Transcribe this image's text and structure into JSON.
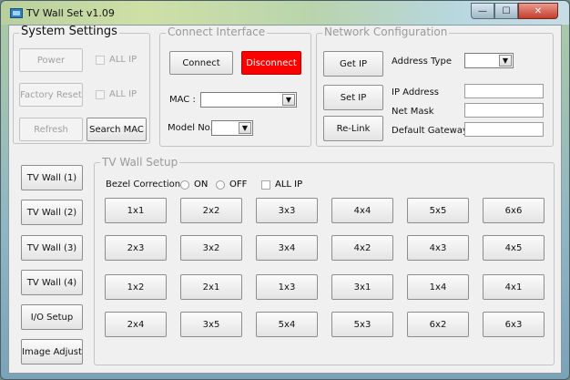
{
  "window": {
    "title": "TV Wall Set v1.09",
    "min_label": "—",
    "max_label": "☐",
    "close_label": "✕"
  },
  "system_settings": {
    "title": "System Settings",
    "power": "Power",
    "factory_reset": "Factory Reset",
    "refresh": "Refresh",
    "search_mac": "Search MAC",
    "all_ip_1": "ALL IP",
    "all_ip_2": "ALL IP"
  },
  "connect_interface": {
    "title": "Connect Interface",
    "connect": "Connect",
    "disconnect": "Disconnect",
    "mac_label": "MAC :",
    "mac_value": "",
    "model_label": "Model No.",
    "model_value": ""
  },
  "network_configuration": {
    "title": "Network Configuration",
    "get_ip": "Get IP",
    "set_ip": "Set IP",
    "relink": "Re-Link",
    "address_type_label": "Address Type",
    "address_type_value": "",
    "ip_address_label": "IP Address",
    "ip_address_value": "",
    "net_mask_label": "Net Mask",
    "net_mask_value": "",
    "default_gateway_label": "Default Gateway",
    "default_gateway_value": ""
  },
  "side_buttons": [
    "TV Wall (1)",
    "TV Wall (2)",
    "TV Wall (3)",
    "TV Wall (4)",
    "I/O Setup",
    "Image Adjust"
  ],
  "tv_wall_setup": {
    "title": "TV Wall Setup",
    "bezel_label": "Bezel Correction",
    "on_label": "ON",
    "off_label": "OFF",
    "all_ip_label": "ALL IP",
    "layouts": [
      [
        "1x1",
        "2x2",
        "3x3",
        "4x4",
        "5x5",
        "6x6"
      ],
      [
        "2x3",
        "3x2",
        "3x4",
        "4x2",
        "4x3",
        "4x5"
      ],
      [
        "1x2",
        "2x1",
        "1x3",
        "3x1",
        "1x4",
        "4x1"
      ],
      [
        "2x4",
        "3x5",
        "5x4",
        "5x3",
        "6x2",
        "6x3"
      ]
    ]
  },
  "colors": {
    "disconnect_bg": "#ff0000",
    "client_bg": "#f0f0f0"
  }
}
